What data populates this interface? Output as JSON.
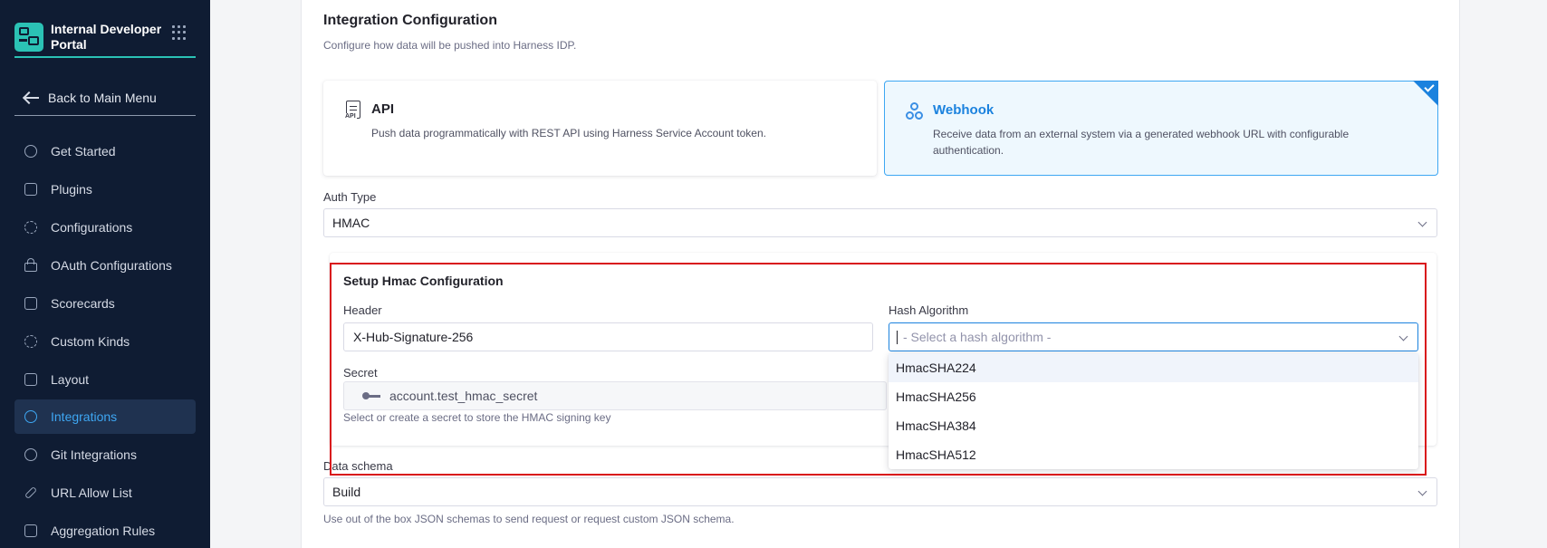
{
  "sidebar": {
    "brand": "Internal Developer Portal",
    "back_label": "Back to Main Menu",
    "items": [
      {
        "label": "Get Started",
        "icon": "get-started-icon"
      },
      {
        "label": "Plugins",
        "icon": "plugins-icon"
      },
      {
        "label": "Configurations",
        "icon": "configurations-icon"
      },
      {
        "label": "OAuth Configurations",
        "icon": "lock-icon"
      },
      {
        "label": "Scorecards",
        "icon": "scorecard-icon"
      },
      {
        "label": "Custom Kinds",
        "icon": "gear-icon"
      },
      {
        "label": "Layout",
        "icon": "layout-icon"
      },
      {
        "label": "Integrations",
        "icon": "integrations-icon",
        "active": true
      },
      {
        "label": "Git Integrations",
        "icon": "git-icon"
      },
      {
        "label": "URL Allow List",
        "icon": "link-icon"
      },
      {
        "label": "Aggregation Rules",
        "icon": "aggregation-icon"
      }
    ]
  },
  "main": {
    "title": "Integration Configuration",
    "subtitle": "Configure how data will be pushed into Harness IDP.",
    "cards": {
      "api": {
        "name": "API",
        "description": "Push data programmatically with REST API using Harness Service Account token.",
        "icon_tag": "API"
      },
      "webhook": {
        "name": "Webhook",
        "description": "Receive data from an external system via a generated webhook URL with configurable authentication.",
        "selected": true
      }
    },
    "auth_type": {
      "label": "Auth Type",
      "value": "HMAC"
    },
    "hmac": {
      "title": "Setup Hmac Configuration",
      "header_label": "Header",
      "header_value": "X-Hub-Signature-256",
      "hash_label": "Hash Algorithm",
      "hash_placeholder": "- Select a hash algorithm -",
      "hash_options": [
        "HmacSHA224",
        "HmacSHA256",
        "HmacSHA384",
        "HmacSHA512"
      ],
      "secret_label": "Secret",
      "secret_value": "account.test_hmac_secret",
      "secret_helper": "Select or create a secret to store the HMAC signing key"
    },
    "data_schema": {
      "label": "Data schema",
      "value": "Build",
      "helper": "Use out of the box JSON schemas to send request or request custom JSON schema."
    }
  },
  "colors": {
    "sidebar_bg": "#0f1c33",
    "accent": "#1b82de",
    "brand_teal": "#2bc2b5",
    "highlight_red": "#d9151b"
  }
}
